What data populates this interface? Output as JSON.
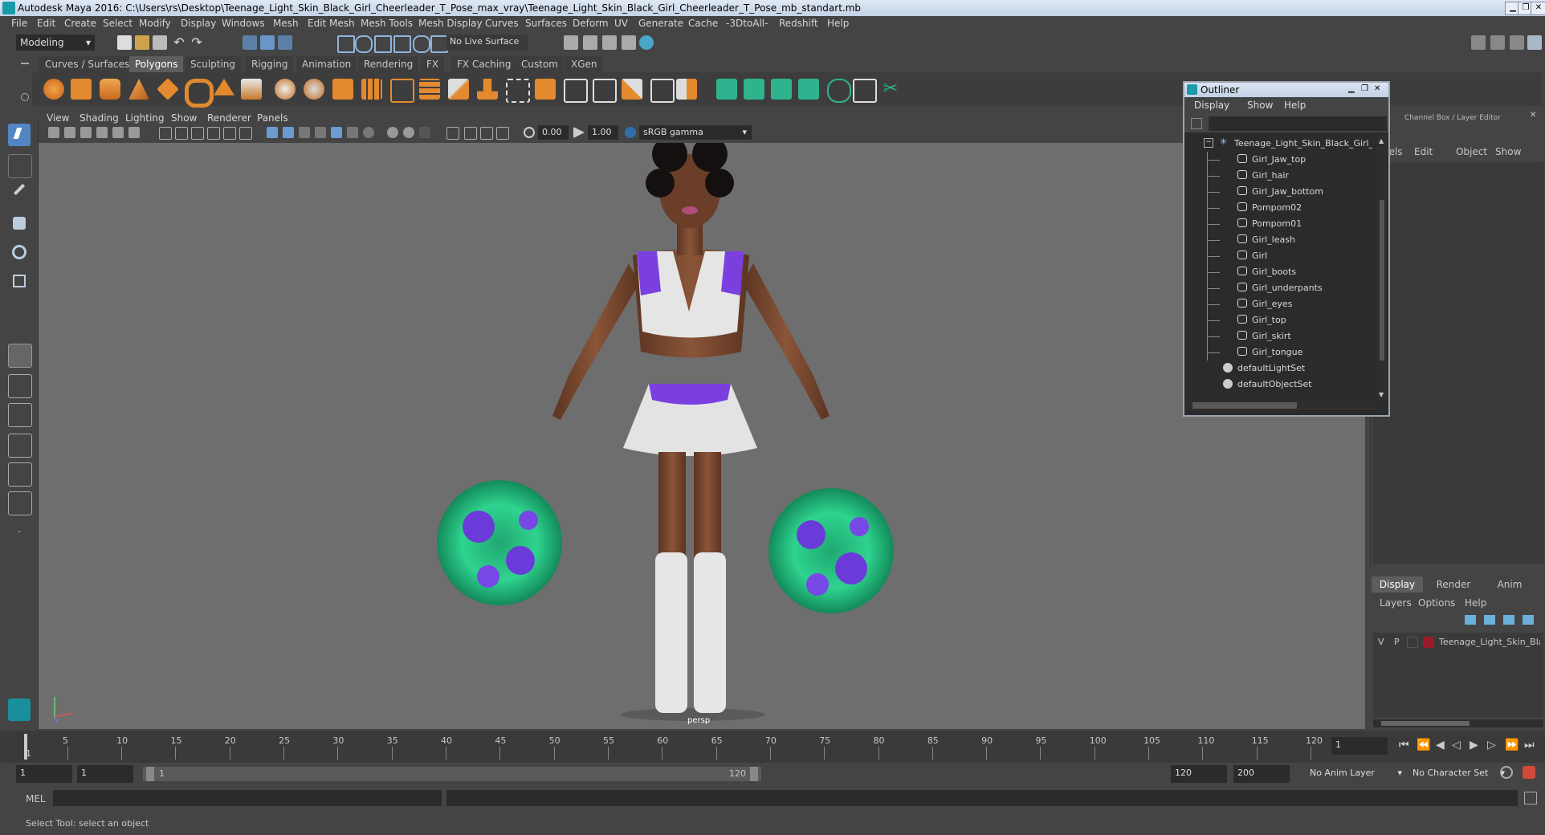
{
  "window": {
    "title": "Autodesk Maya 2016: C:\\Users\\rs\\Desktop\\Teenage_Light_Skin_Black_Girl_Cheerleader_T_Pose_max_vray\\Teenage_Light_Skin_Black_Girl_Cheerleader_T_Pose_mb_standart.mb"
  },
  "menubar": [
    "File",
    "Edit",
    "Create",
    "Select",
    "Modify",
    "Display",
    "Windows",
    "Mesh",
    "Edit Mesh",
    "Mesh Tools",
    "Mesh Display",
    "Curves",
    "Surfaces",
    "Deform",
    "UV",
    "Generate",
    "Cache",
    "-3DtoAll-",
    "Redshift",
    "Help"
  ],
  "statusline": {
    "mode": "Modeling",
    "live_surface": "No Live Surface"
  },
  "shelf": {
    "tabs": [
      "Curves / Surfaces",
      "Polygons",
      "Sculpting",
      "Rigging",
      "Animation",
      "Rendering",
      "FX",
      "FX Caching",
      "Custom",
      "XGen"
    ],
    "active_tab": "Polygons"
  },
  "viewport": {
    "menu": [
      "View",
      "Shading",
      "Lighting",
      "Show",
      "Renderer",
      "Panels"
    ],
    "field_a": "0.00",
    "field_b": "1.00",
    "color_space": "sRGB gamma",
    "camera_label": "persp"
  },
  "outliner": {
    "title": "Outliner",
    "menu": [
      "Display",
      "Show",
      "Help"
    ],
    "root": "Teenage_Light_Skin_Black_Girl_Cl",
    "children": [
      "Girl_Jaw_top",
      "Girl_hair",
      "Girl_Jaw_bottom",
      "Pompom02",
      "Pompom01",
      "Girl_leash",
      "Girl",
      "Girl_boots",
      "Girl_underpants",
      "Girl_eyes",
      "Girl_top",
      "Girl_skirt",
      "Girl_tongue"
    ],
    "sets": [
      "defaultLightSet",
      "defaultObjectSet"
    ]
  },
  "channelbox": {
    "header": "Channel Box / Layer Editor",
    "menu": [
      "annels",
      "Edit",
      "Object",
      "Show"
    ]
  },
  "layer_editor": {
    "tabs": [
      "Display",
      "Render",
      "Anim"
    ],
    "active_tab": "Display",
    "menu": [
      "Layers",
      "Options",
      "Help"
    ],
    "layer": {
      "v": "V",
      "p": "P",
      "name": "Teenage_Light_Skin_Bla",
      "color": "#9b1b2a"
    }
  },
  "timeslider": {
    "ticks": [
      "5",
      "10",
      "15",
      "20",
      "25",
      "30",
      "35",
      "40",
      "45",
      "50",
      "55",
      "60",
      "65",
      "70",
      "75",
      "80",
      "85",
      "90",
      "95",
      "100",
      "105",
      "110",
      "115",
      "120"
    ],
    "start_marker": "1",
    "current_frame": "1"
  },
  "rangeslider": {
    "start": "1",
    "inner_start": "1",
    "range_start_label": "1",
    "range_end_label": "120",
    "end": "120",
    "total_end": "200",
    "anim_layer": "No Anim Layer",
    "character_set": "No Character Set"
  },
  "cmdline": {
    "label": "MEL"
  },
  "helpline": {
    "text": "Select Tool: select an object"
  }
}
